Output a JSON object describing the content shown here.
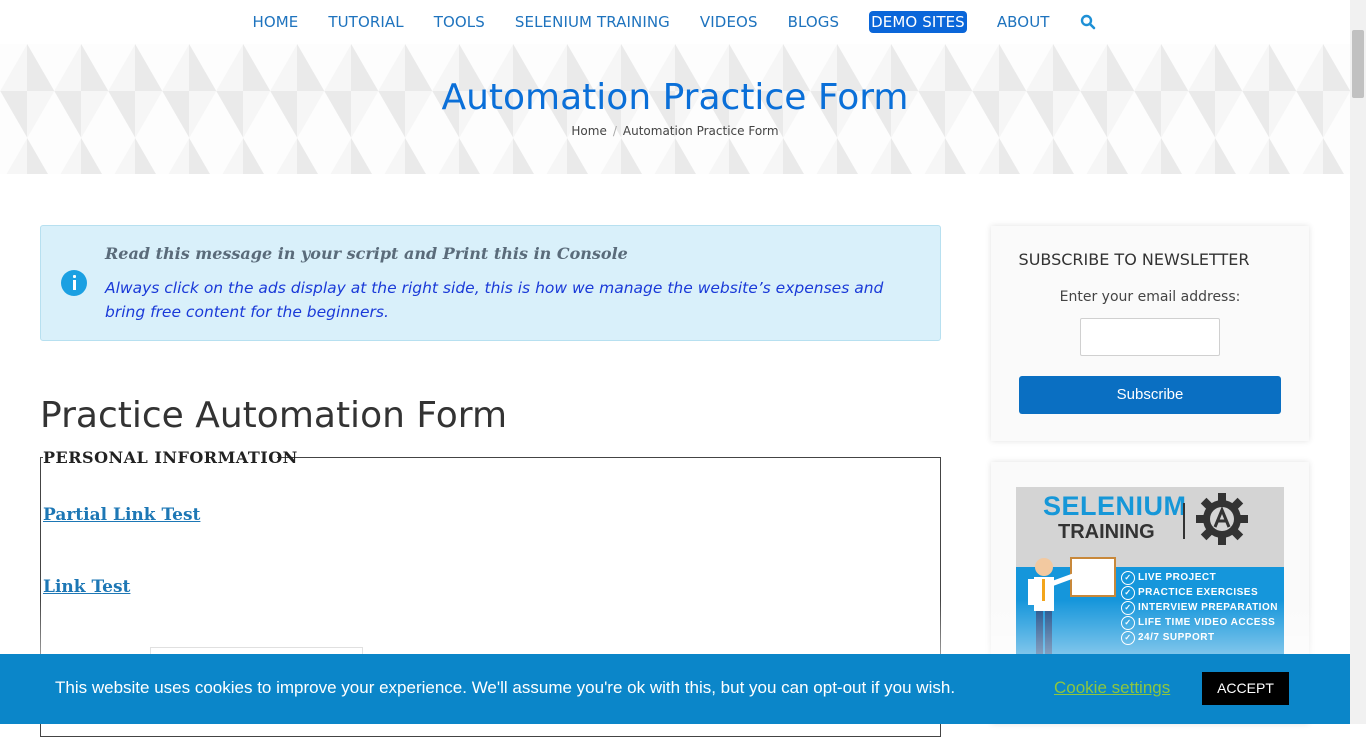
{
  "nav": {
    "items": [
      "HOME",
      "TUTORIAL",
      "TOOLS",
      "SELENIUM TRAINING",
      "VIDEOS",
      "BLOGS",
      "DEMO SITES",
      "ABOUT"
    ],
    "active": "DEMO SITES",
    "search_icon": "search-icon",
    "link_color": "#1e73be",
    "active_bg": "#0a66d9"
  },
  "hero": {
    "title": "Automation Practice Form",
    "breadcrumb_home": "Home",
    "breadcrumb_separator": "/",
    "breadcrumb_current": "Automation Practice Form",
    "title_color": "#0a6fd8"
  },
  "info": {
    "icon": "info-icon",
    "title": "Read this message in your script and Print this in Console",
    "message": "Always click on the ads display at the right side, this is how we manage the website’s expenses and bring free content for the beginners."
  },
  "main": {
    "heading": "Practice Automation Form",
    "legend": "PERSONAL INFORMATION",
    "link1": "Partial Link Test",
    "link2": "Link Test"
  },
  "sidebar": {
    "newsletter_title": "SUBSCRIBE TO NEWSLETTER",
    "email_label": "Enter your email address:",
    "email_value": "",
    "subscribe_label": "Subscribe",
    "ad": {
      "line1": "SELENIUM",
      "line2": "TRAINING",
      "features": [
        "LIVE PROJECT",
        "PRACTICE EXERCISES",
        "INTERVIEW PREPARATION",
        "LIFE TIME VIDEO ACCESS",
        "24/7 SUPPORT"
      ]
    }
  },
  "cookie": {
    "text": "This website uses cookies to improve your experience. We'll assume you're ok with this, but you can opt-out if you wish.",
    "settings_label": "Cookie settings",
    "accept_label": "ACCEPT",
    "bg_color": "#0b86c9",
    "settings_color": "#8dc63f"
  }
}
